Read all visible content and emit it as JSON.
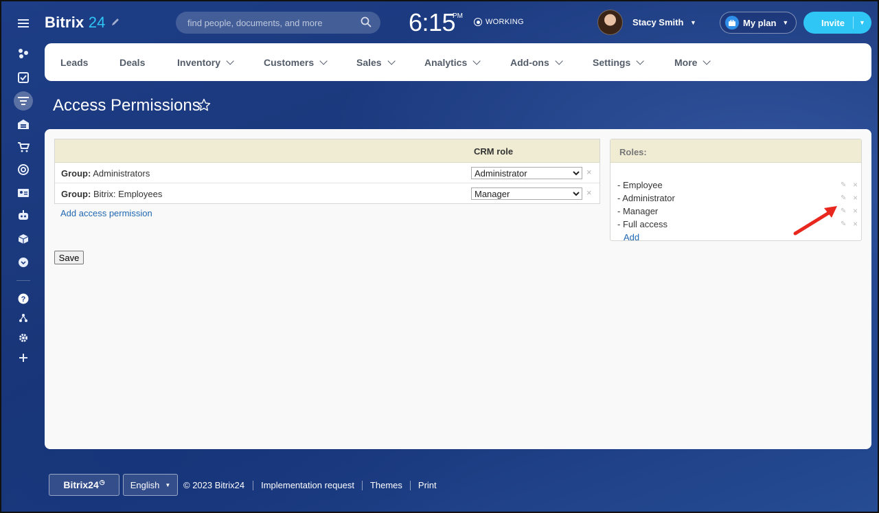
{
  "header": {
    "brand": "Bitrix",
    "brand_number": "24",
    "search_placeholder": "find people, documents, and more",
    "clock_time": "6:15",
    "clock_period": "PM",
    "status": "WORKING",
    "user_name": "Stacy Smith",
    "my_plan_label": "My plan",
    "invite_label": "Invite"
  },
  "left_rail": {
    "icons": [
      "menu-icon",
      "feed-icon",
      "tasks-icon",
      "crm-icon",
      "warehouse-icon",
      "shop-icon",
      "goals-icon",
      "contact-card-icon",
      "robot-icon",
      "package-icon",
      "more-icon",
      "help-icon",
      "sitemap-icon",
      "settings-icon",
      "add-icon"
    ]
  },
  "nav": {
    "items": [
      {
        "label": "Leads",
        "dropdown": false
      },
      {
        "label": "Deals",
        "dropdown": false
      },
      {
        "label": "Inventory",
        "dropdown": true
      },
      {
        "label": "Customers",
        "dropdown": true
      },
      {
        "label": "Sales",
        "dropdown": true
      },
      {
        "label": "Analytics",
        "dropdown": true
      },
      {
        "label": "Add-ons",
        "dropdown": true
      },
      {
        "label": "Settings",
        "dropdown": true
      },
      {
        "label": "More",
        "dropdown": true
      }
    ]
  },
  "page": {
    "title": "Access Permissions"
  },
  "permissions": {
    "column_header": "CRM role",
    "group_prefix": "Group:",
    "rows": [
      {
        "group": "Administrators",
        "role": "Administrator"
      },
      {
        "group": "Bitrix: Employees",
        "role": "Manager"
      }
    ],
    "role_options": [
      "Administrator",
      "Manager",
      "Employee",
      "Full access"
    ],
    "delete_glyph": "×",
    "add_link": "Add access permission",
    "save_label": "Save"
  },
  "roles": {
    "header": "Roles:",
    "items": [
      "- Employee",
      "- Administrator",
      "- Manager",
      "- Full access"
    ],
    "add_link": "Add",
    "annotation_color": "#e8281e"
  },
  "footer": {
    "brand": "Bitrix24",
    "language": "English",
    "copyright": "© 2023 Bitrix24",
    "links": [
      "Implementation request",
      "Themes",
      "Print"
    ]
  },
  "colors": {
    "accent": "#2fc6f6",
    "link": "#2067b0",
    "table_header": "#efecd3"
  }
}
